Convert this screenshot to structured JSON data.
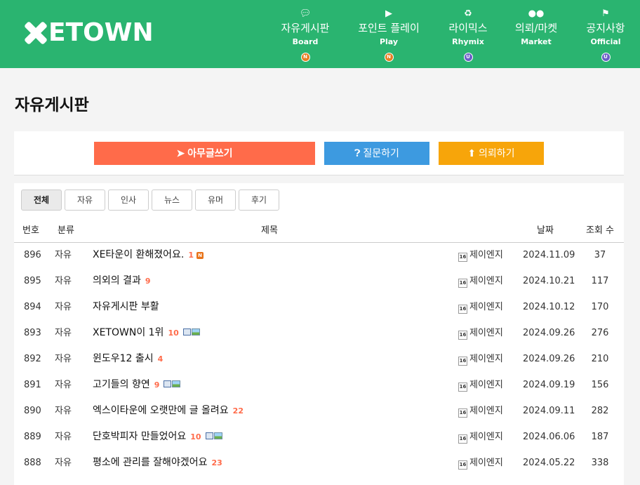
{
  "header": {
    "logo_text": "ETOWN",
    "nav": [
      {
        "icon": "speech-bubbles-icon",
        "label": "자유게시판",
        "sub": "Board",
        "badge": "N"
      },
      {
        "icon": "play-icon",
        "label": "포인트 플레이",
        "sub": "Play",
        "badge": "N"
      },
      {
        "icon": "recycle-icon",
        "label": "라이믹스",
        "sub": "Rhymix",
        "badge": "U"
      },
      {
        "icon": "users-icon",
        "label": "의뢰/마켓",
        "sub": "Market",
        "badge": ""
      },
      {
        "icon": "flag-icon",
        "label": "공지사항",
        "sub": "Official",
        "badge": "U"
      }
    ]
  },
  "page_title": "자유게시판",
  "buttons": {
    "write": "아무글쓰기",
    "ask": "질문하기",
    "request": "의뢰하기"
  },
  "tabs": [
    "전체",
    "자유",
    "인사",
    "뉴스",
    "유머",
    "후기"
  ],
  "active_tab": "전체",
  "columns": {
    "no": "번호",
    "category": "분류",
    "title": "제목",
    "date": "날짜",
    "views": "조회 수"
  },
  "level_icon": "16",
  "rows": [
    {
      "no": "896",
      "category": "자유",
      "title": "XE타운이 환해졌어요.",
      "comments": "1",
      "new": "N",
      "file": false,
      "image": false,
      "author": "제이엔지",
      "date": "2024.11.09",
      "views": "37"
    },
    {
      "no": "895",
      "category": "자유",
      "title": "의외의 결과",
      "comments": "9",
      "new": "",
      "file": false,
      "image": false,
      "author": "제이엔지",
      "date": "2024.10.21",
      "views": "117"
    },
    {
      "no": "894",
      "category": "자유",
      "title": "자유게시판 부활",
      "comments": "",
      "new": "",
      "file": false,
      "image": false,
      "author": "제이엔지",
      "date": "2024.10.12",
      "views": "170"
    },
    {
      "no": "893",
      "category": "자유",
      "title": "XETOWN이 1위",
      "comments": "10",
      "new": "",
      "file": true,
      "image": true,
      "author": "제이엔지",
      "date": "2024.09.26",
      "views": "276"
    },
    {
      "no": "892",
      "category": "자유",
      "title": "윈도우12 출시",
      "comments": "4",
      "new": "",
      "file": false,
      "image": false,
      "author": "제이엔지",
      "date": "2024.09.26",
      "views": "210"
    },
    {
      "no": "891",
      "category": "자유",
      "title": "고기들의 향연",
      "comments": "9",
      "new": "",
      "file": true,
      "image": true,
      "author": "제이엔지",
      "date": "2024.09.19",
      "views": "156"
    },
    {
      "no": "890",
      "category": "자유",
      "title": "엑스이타운에 오랫만에 글 올려요",
      "comments": "22",
      "new": "",
      "file": false,
      "image": false,
      "author": "제이엔지",
      "date": "2024.09.11",
      "views": "282"
    },
    {
      "no": "889",
      "category": "자유",
      "title": "단호박피자 만들었어요",
      "comments": "10",
      "new": "",
      "file": true,
      "image": true,
      "author": "제이엔지",
      "date": "2024.06.06",
      "views": "187"
    },
    {
      "no": "888",
      "category": "자유",
      "title": "평소에 관리를 잘해야겠어요",
      "comments": "23",
      "new": "",
      "file": false,
      "image": false,
      "author": "제이엔지",
      "date": "2024.05.22",
      "views": "338"
    }
  ]
}
